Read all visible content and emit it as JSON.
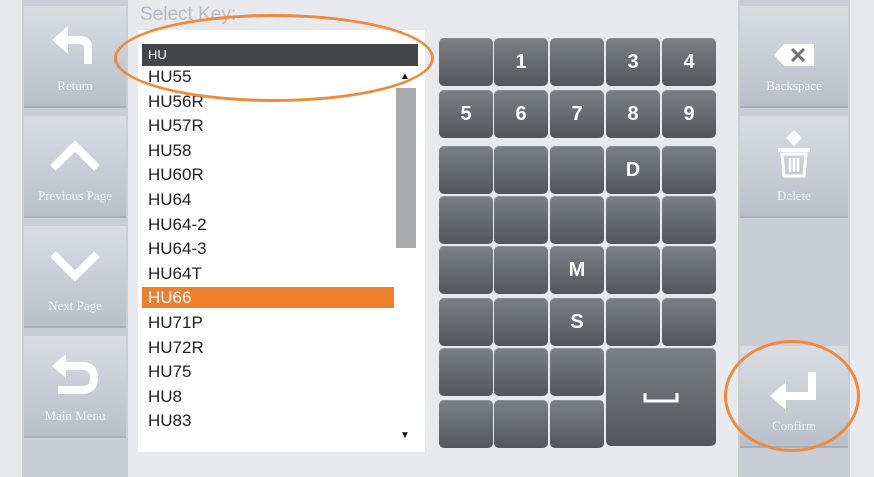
{
  "prompt": "Select Key:",
  "search": {
    "value": "HU"
  },
  "list": {
    "items": [
      "HU55",
      "HU56R",
      "HU57R",
      "HU58",
      "HU60R",
      "HU64",
      "HU64-2",
      "HU64-3",
      "HU64T",
      "HU66",
      "HU71P",
      "HU72R",
      "HU75",
      "HU8",
      "HU83"
    ],
    "selected": "HU66"
  },
  "left_buttons": [
    {
      "label": "Return",
      "icon": "return-arrow-icon"
    },
    {
      "label": "Previous Page",
      "icon": "chevron-up-icon"
    },
    {
      "label": "Next Page",
      "icon": "chevron-down-icon"
    },
    {
      "label": "Main Menu",
      "icon": "main-menu-arrow-icon"
    }
  ],
  "right_buttons": [
    {
      "label": "Backspace",
      "icon": "backspace-icon"
    },
    {
      "label": "Delete",
      "icon": "trash-icon"
    },
    {
      "label": "Confirm",
      "icon": "enter-icon"
    }
  ],
  "keypad": {
    "keys": [
      "",
      "1",
      "",
      "3",
      "4",
      "5",
      "6",
      "7",
      "8",
      "9",
      "",
      "",
      "",
      "D",
      "",
      "",
      "",
      "",
      "",
      "",
      "",
      "",
      "M",
      "",
      "",
      "",
      "",
      "S",
      "",
      "",
      "",
      "",
      "",
      "",
      ""
    ],
    "space_label": "␣"
  },
  "colors": {
    "accent": "#f07f2d",
    "highlight_ring": "#ef8a3a"
  }
}
